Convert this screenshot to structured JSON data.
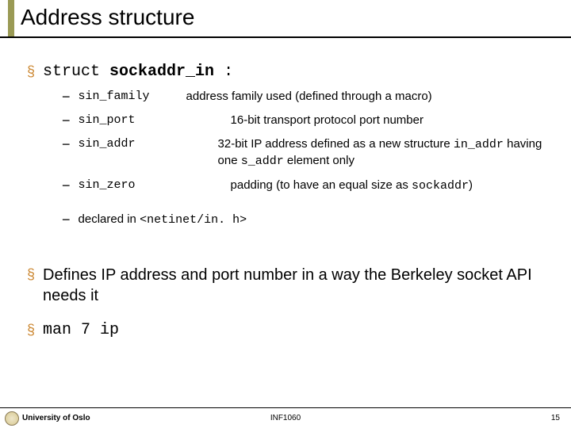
{
  "title": "Address structure",
  "bullet1_glyph": "§",
  "bullet2_glyph": "−",
  "main": {
    "struct_prefix": "struct ",
    "struct_name": "sockaddr_in",
    "struct_suffix": " :",
    "items": [
      {
        "term": "sin_family",
        "desc_plain": "address family used (defined through a macro)"
      },
      {
        "term": "sin_port",
        "desc_plain": "16-bit transport protocol port number"
      },
      {
        "term": "sin_addr",
        "desc_pre": "32-bit IP address defined as a new structure ",
        "desc_code1": "in_addr",
        "desc_mid1": " having one ",
        "desc_code2": "s_addr",
        "desc_post": " element only"
      },
      {
        "term": "sin_zero",
        "desc_pre2": "padding (to have an equal size as ",
        "desc_code3": "sockaddr",
        "desc_post2": ")"
      }
    ],
    "declared_prefix": "declared in ",
    "declared_code": "<netinet/in. h>"
  },
  "point2": "Defines IP address and port number in a way the Berkeley socket API needs it",
  "point3": "man 7 ip",
  "footer": {
    "left": "University of Oslo",
    "center": "INF1060",
    "right": "15"
  }
}
